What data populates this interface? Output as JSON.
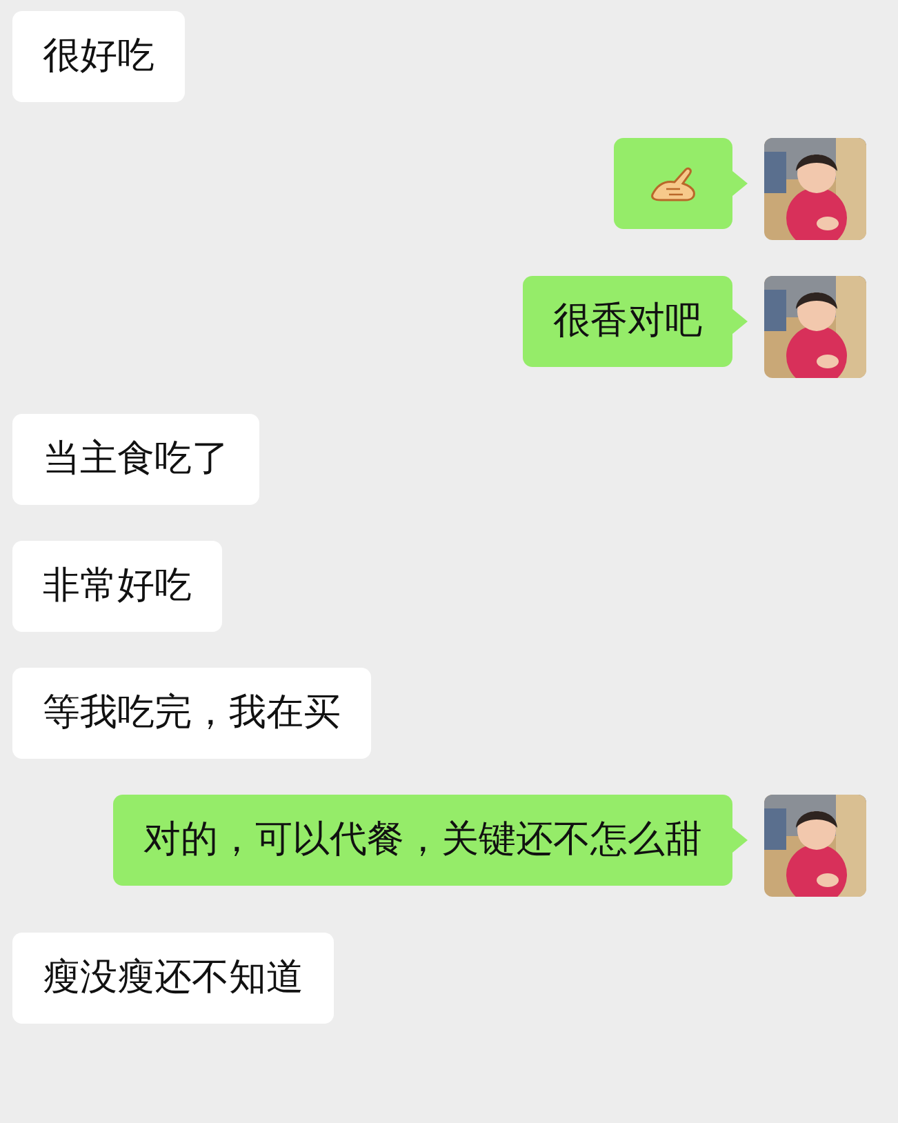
{
  "messages": [
    {
      "kind": "received",
      "text": "很好吃"
    },
    {
      "kind": "sent_emoji"
    },
    {
      "kind": "sent",
      "text": "很香对吧"
    },
    {
      "kind": "received",
      "text": "当主食吃了"
    },
    {
      "kind": "received",
      "text": "非常好吃"
    },
    {
      "kind": "received",
      "text": "等我吃完，我在买"
    },
    {
      "kind": "sent",
      "text": "对的，可以代餐，关键还不怎么甜"
    },
    {
      "kind": "received",
      "text": "瘦没瘦还不知道"
    }
  ]
}
